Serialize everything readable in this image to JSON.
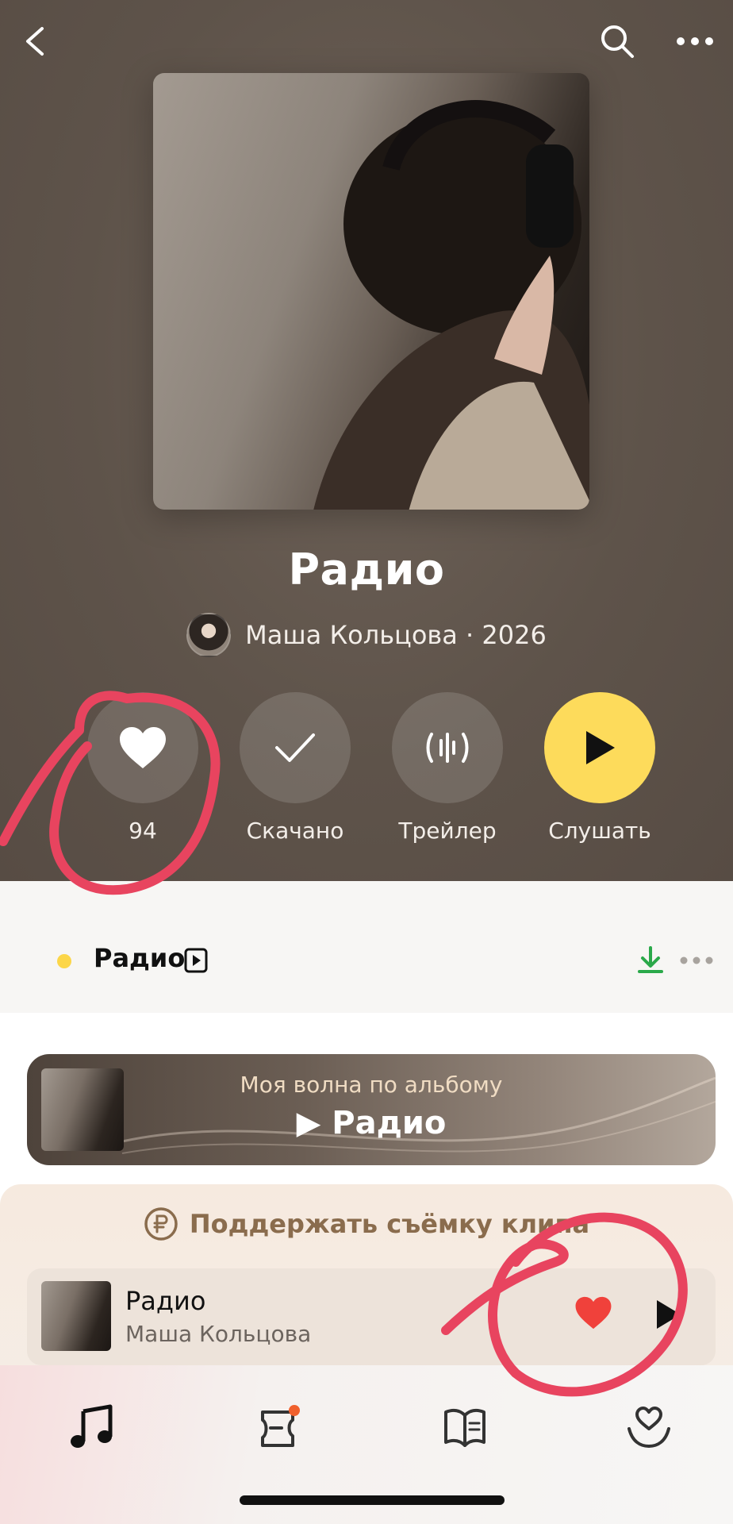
{
  "album": {
    "title": "Радио",
    "artist_line": "Маша Кольцова · 2026"
  },
  "actions": [
    {
      "label": "94",
      "icon": "heart-icon"
    },
    {
      "label": "Скачано",
      "icon": "check-icon"
    },
    {
      "label": "Трейлер",
      "icon": "waveform-icon"
    },
    {
      "label": "Слушать",
      "icon": "play-icon"
    }
  ],
  "track_header": {
    "title": "Радио"
  },
  "wave_card": {
    "subtitle": "Моя волна по альбому",
    "title": "▶ Радио"
  },
  "support": {
    "label": "Поддержать съёмку клипа"
  },
  "mini_player": {
    "title": "Радио",
    "artist": "Маша Кольцова"
  },
  "colors": {
    "accent_yellow": "#fddb5b",
    "annotation_red": "#e8445f",
    "download_green": "#2ba94a",
    "like_red": "#f0413b"
  }
}
